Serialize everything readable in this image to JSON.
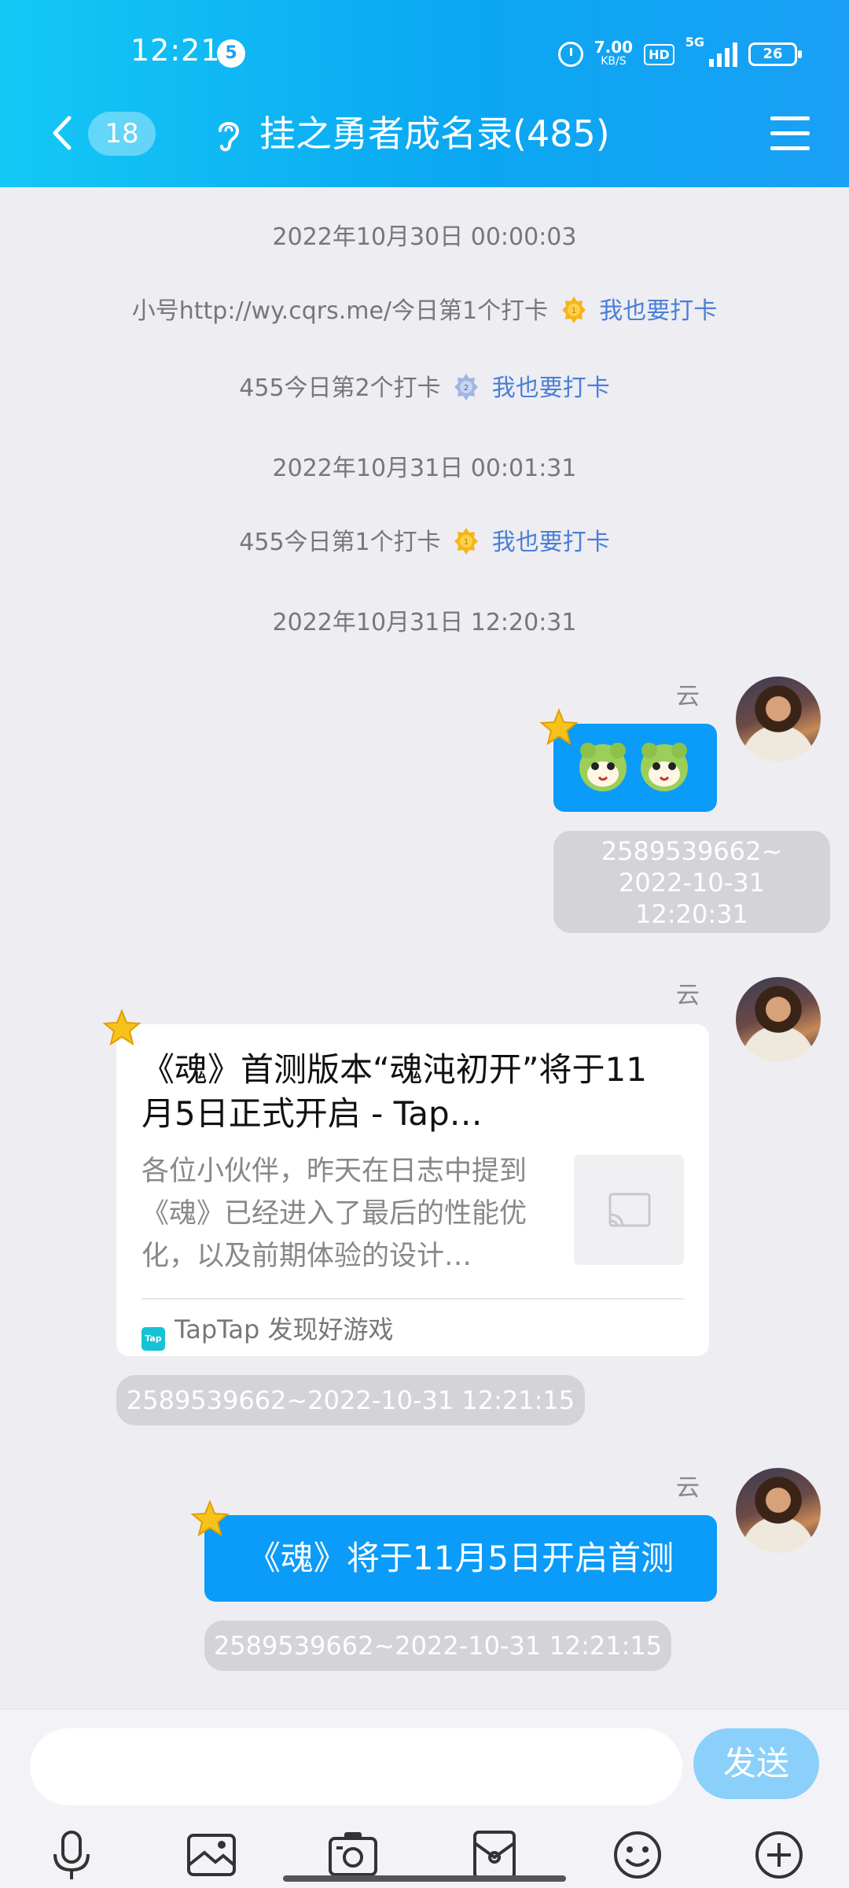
{
  "status_bar": {
    "time": "12:21",
    "notification_count": "5",
    "net_speed_value": "7.00",
    "net_speed_unit": "KB/S",
    "hd_label": "HD",
    "network_label": "5G",
    "battery": "26"
  },
  "nav": {
    "unread_count": "18",
    "title": "挂之勇者成名录(485)"
  },
  "system_messages": [
    {
      "timestamp": "2022年10月30日 00:00:03"
    },
    {
      "text": "小号http://wy.cqrs.me/今日第1个打卡",
      "rank": "1",
      "link": "我也要打卡"
    },
    {
      "text": "455今日第2个打卡",
      "rank": "2",
      "link": "我也要打卡"
    },
    {
      "timestamp": "2022年10月31日 00:01:31"
    },
    {
      "text": "455今日第1个打卡",
      "rank": "1",
      "link": "我也要打卡"
    },
    {
      "timestamp": "2022年10月31日 12:20:31"
    }
  ],
  "messages": [
    {
      "sender": "云",
      "type": "stickers",
      "stamp_lines": [
        "2589539662~",
        "2022-10-31",
        "12:20:31"
      ]
    },
    {
      "sender": "云",
      "type": "link_card",
      "card": {
        "title": "《魂》首测版本“魂沌初开”将于11月5日正式开启 - Tap…",
        "description": "各位小伙伴，昨天在日志中提到《魂》已经进入了最后的性能优化，以及前期体验的设计…",
        "source": "TapTap 发现好游戏",
        "source_icon_text": "Tap"
      },
      "stamp": "2589539662~2022-10-31 12:21:15"
    },
    {
      "sender": "云",
      "type": "text",
      "text": "《魂》将于11月5日开启首测",
      "stamp": "2589539662~2022-10-31 12:21:15"
    }
  ],
  "composer": {
    "input_value": "",
    "send_label": "发送"
  },
  "toolbar_icons": [
    "microphone-icon",
    "image-icon",
    "camera-icon",
    "red-packet-icon",
    "emoji-icon",
    "plus-icon"
  ],
  "colors": {
    "header_start": "#14c8f5",
    "header_end": "#1aa0f5",
    "bubble_blue": "#0b9bf8",
    "link_blue": "#4a7fd8",
    "send_button": "#8ad0fb",
    "background": "#ededf2"
  }
}
